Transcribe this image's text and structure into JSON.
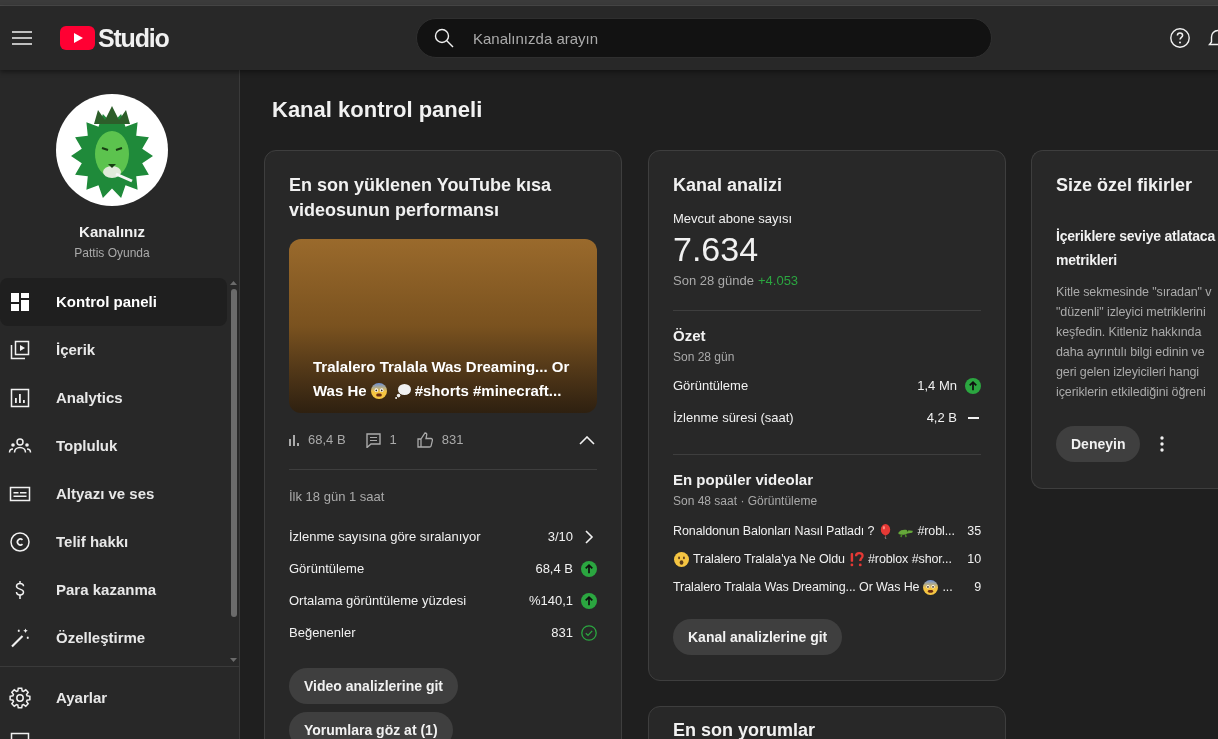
{
  "header": {
    "logo_text": "Studio",
    "search": {
      "placeholder": "Kanalınızda arayın"
    }
  },
  "channel": {
    "name": "Kanalınız",
    "handle": "Pattis Oyunda"
  },
  "sidebar": {
    "items": [
      {
        "kind": "dashboard",
        "label": "Kontrol paneli",
        "selected": true
      },
      {
        "kind": "content",
        "label": "İçerik",
        "selected": false
      },
      {
        "kind": "analytics",
        "label": "Analytics",
        "selected": false
      },
      {
        "kind": "community",
        "label": "Topluluk",
        "selected": false
      },
      {
        "kind": "subtitles",
        "label": "Altyazı ve ses",
        "selected": false
      },
      {
        "kind": "copyright",
        "label": "Telif hakkı",
        "selected": false
      },
      {
        "kind": "earn",
        "label": "Para kazanma",
        "selected": false
      },
      {
        "kind": "customize",
        "label": "Özelleştirme",
        "selected": false
      }
    ],
    "bottom_items": [
      {
        "kind": "settings",
        "label": "Ayarlar",
        "selected": false
      }
    ]
  },
  "page_title": "Kanal kontrol paneli",
  "latest_short": {
    "title": "En son yüklenen YouTube kısa videosunun performansı",
    "video_title_lines": [
      [
        {
          "kind": "text",
          "text": "Tralalero Tralala Was Dreaming... Or"
        }
      ],
      [
        {
          "kind": "text",
          "text": "Was He"
        },
        {
          "kind": "scared"
        },
        {
          "kind": "thought"
        },
        {
          "kind": "text",
          "text": "#shorts #minecraft..."
        }
      ]
    ],
    "stats": [
      {
        "kind": "views",
        "value": "68,4 B"
      },
      {
        "kind": "comments",
        "value": "1"
      },
      {
        "kind": "likes",
        "value": "831"
      }
    ],
    "expanded": true,
    "period": "İlk 18 gün 1 saat",
    "metrics": [
      {
        "kind": "link",
        "label": "İzlenme sayısına göre sıralanıyor",
        "value": "3/10"
      },
      {
        "kind": "up",
        "label": "Görüntüleme",
        "value": "68,4 B"
      },
      {
        "kind": "up",
        "label": "Ortalama görüntüleme yüzdesi",
        "value": "%140,1"
      },
      {
        "kind": "check",
        "label": "Beğenenler",
        "value": "831"
      }
    ],
    "buttons": [
      "Video analizlerine git",
      "Yorumlara göz at (1)"
    ]
  },
  "channel_analytics": {
    "title": "Kanal analizi",
    "subscribers_label": "Mevcut abone sayısı",
    "subscribers": "7.634",
    "change_period": "Son 28 günde",
    "change": "+4.053",
    "summary": {
      "title": "Özet",
      "period": "Son 28 gün",
      "metrics": [
        {
          "kind": "up",
          "label": "Görüntüleme",
          "value": "1,4 Mn"
        },
        {
          "kind": "flat",
          "label": "İzlenme süresi (saat)",
          "value": "4,2 B"
        }
      ]
    },
    "top_videos": {
      "title": "En popüler videolar",
      "period": "Son 48 saat · Görüntüleme",
      "videos": [
        {
          "title": [
            {
              "kind": "text",
              "text": "Ronaldonun Balonları Nasıl Patladı ?"
            },
            {
              "kind": "balloon"
            },
            {
              "kind": "crocodile"
            },
            {
              "kind": "text",
              "text": "#robl..."
            }
          ],
          "views": "35"
        },
        {
          "title": [
            {
              "kind": "surprised"
            },
            {
              "kind": "text",
              "text": "Tralalero Tralala'ya Ne Oldu"
            },
            {
              "kind": "interrobang"
            },
            {
              "kind": "text",
              "text": "#roblox #shor..."
            }
          ],
          "views": "10"
        },
        {
          "title": [
            {
              "kind": "text",
              "text": "Tralalero Tralala Was Dreaming... Or Was He"
            },
            {
              "kind": "scared"
            },
            {
              "kind": "text",
              "text": "..."
            }
          ],
          "views": "9"
        }
      ]
    },
    "button": "Kanal analizlerine git"
  },
  "ideas": {
    "title": "Size özel fikirler",
    "heading_lines": [
      "İçeriklere seviye atlataca",
      "metrikleri"
    ],
    "body_lines": [
      "Kitle sekmesinde \"sıradan\" v",
      "\"düzenli\" izleyici metriklerini",
      "keşfedin. Kitleniz hakkında",
      "daha ayrıntılı bilgi edinin ve",
      "geri gelen izleyicileri hangi",
      "içeriklerin etkilediğini öğreni"
    ],
    "button": "Deneyin"
  },
  "latest_comments": {
    "title": "En son yorumlar"
  }
}
